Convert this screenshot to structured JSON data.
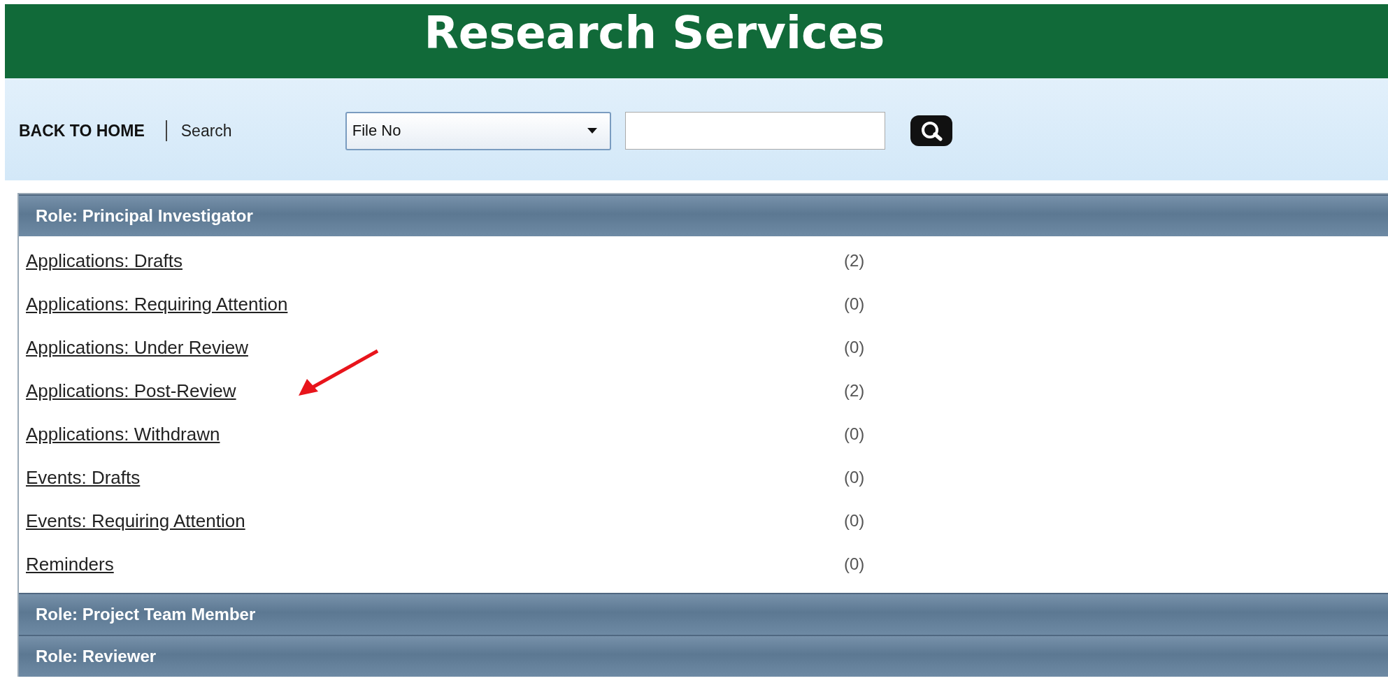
{
  "header": {
    "title": "Research Services"
  },
  "nav": {
    "home_link": "BACK TO HOME",
    "search_label": "Search",
    "search_field": {
      "value": "File No"
    }
  },
  "roles": [
    {
      "title": "Role: Principal Investigator",
      "items": [
        {
          "label": "Applications: Drafts",
          "count": "(2)"
        },
        {
          "label": "Applications: Requiring Attention",
          "count": "(0)"
        },
        {
          "label": "Applications: Under Review",
          "count": "(0)"
        },
        {
          "label": "Applications: Post-Review",
          "count": "(2)"
        },
        {
          "label": "Applications: Withdrawn",
          "count": "(0)"
        },
        {
          "label": "Events: Drafts",
          "count": "(0)"
        },
        {
          "label": "Events: Requiring Attention",
          "count": "(0)"
        },
        {
          "label": "Reminders",
          "count": "(0)"
        }
      ]
    },
    {
      "title": "Role: Project Team Member"
    },
    {
      "title": "Role: Reviewer"
    }
  ]
}
